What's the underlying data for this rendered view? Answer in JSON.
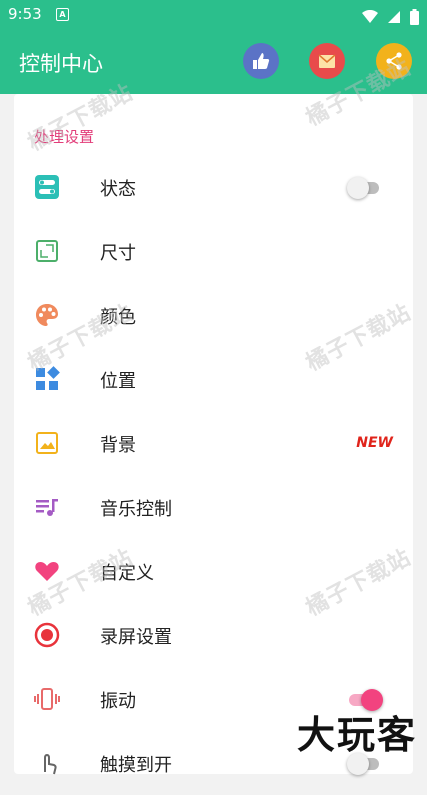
{
  "status_bar": {
    "time": "9:53",
    "notification_badge": "A"
  },
  "header": {
    "title": "控制中心",
    "actions": [
      {
        "name": "like-button",
        "icon": "thumbs-up-icon",
        "color": "#5b73c6"
      },
      {
        "name": "message-button",
        "icon": "envelope-icon",
        "color": "#e84b4b"
      },
      {
        "name": "share-button",
        "icon": "share-icon",
        "color": "#f2b21b"
      }
    ]
  },
  "section": {
    "title": "处理设置"
  },
  "items": [
    {
      "label": "状态",
      "icon": "toggles-icon",
      "color": "#2bbfb6",
      "toggle": false
    },
    {
      "label": "尺寸",
      "icon": "resize-icon",
      "color": "#4caf6a"
    },
    {
      "label": "颜色",
      "icon": "palette-icon",
      "color": "#f08a5d"
    },
    {
      "label": "位置",
      "icon": "grid-icon",
      "color": "#3d8be0"
    },
    {
      "label": "背景",
      "icon": "image-icon",
      "color": "#f2b21b",
      "badge": "NEW"
    },
    {
      "label": "音乐控制",
      "icon": "music-list-icon",
      "color": "#a45bc4"
    },
    {
      "label": "自定义",
      "icon": "heart-icon",
      "color": "#f2437f"
    },
    {
      "label": "录屏设置",
      "icon": "record-icon",
      "color": "#e8333b"
    },
    {
      "label": "振动",
      "icon": "vibrate-icon",
      "color": "#e86a6a",
      "toggle": true
    },
    {
      "label": "触摸到开",
      "icon": "touch-icon",
      "color": "#666666",
      "toggle": false
    }
  ],
  "watermarks": [
    "橘子下载站",
    "橘子下载站",
    "橘子下载站",
    "橘子下载站",
    "橘子下载站",
    "橘子下载站"
  ],
  "corner_logo": "大玩客",
  "colors": {
    "primary": "#2bbf8c",
    "accent": "#e23e7a",
    "new_badge": "#e0241b"
  }
}
